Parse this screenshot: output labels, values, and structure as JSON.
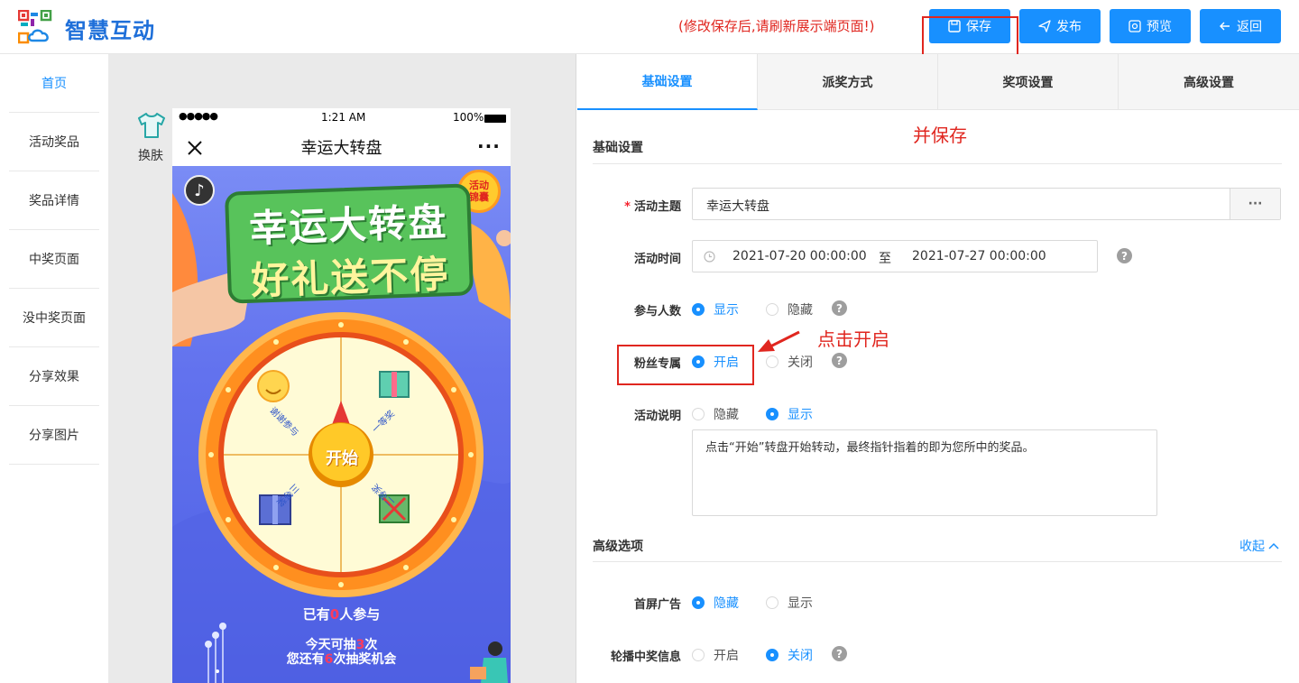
{
  "header": {
    "app_name": "智慧互动",
    "notice": "(修改保存后,请刷新展示端页面!)",
    "buttons": {
      "save": "保存",
      "publish": "发布",
      "preview": "预览",
      "back": "返回"
    }
  },
  "annotations": {
    "save_hint": "并保存",
    "open_hint": "点击开启"
  },
  "colors": {
    "primary": "#1890ff",
    "alert": "#e0261f"
  },
  "leftnav": {
    "items": [
      "首页",
      "活动奖品",
      "奖品详情",
      "中奖页面",
      "没中奖页面",
      "分享效果",
      "分享图片"
    ]
  },
  "preview": {
    "skin_label": "换肤",
    "status": {
      "signal": "●●●●●",
      "time": "1:21 AM",
      "battery": "100%"
    },
    "title": "幸运大转盘",
    "banner": {
      "line1": "幸运大转盘",
      "line2": "好礼送不停"
    },
    "badge": {
      "line1": "活动",
      "line2": "锦囊"
    },
    "wheel": {
      "start": "开始",
      "prizes": [
        "谢谢参与",
        "一等奖",
        "二等奖",
        "三等奖"
      ]
    },
    "participants": {
      "prefix": "已有",
      "count": "0",
      "suffix": "人参与"
    },
    "today": {
      "prefix": "今天可抽",
      "count": "3",
      "suffix": "次"
    },
    "remaining": {
      "prefix": "您还有",
      "count": "6",
      "suffix": "次抽奖机会"
    }
  },
  "tabs": [
    "基础设置",
    "派奖方式",
    "奖项设置",
    "高级设置"
  ],
  "form": {
    "basic_title": "基础设置",
    "topic": {
      "label": "活动主题",
      "value": "幸运大转盘",
      "more": "···"
    },
    "time": {
      "label": "活动时间",
      "start": "2021-07-20 00:00:00",
      "sep": "至",
      "end": "2021-07-27 00:00:00"
    },
    "participants": {
      "label": "参与人数",
      "options": [
        "显示",
        "隐藏"
      ],
      "selected": 0
    },
    "fans_only": {
      "label": "粉丝专属",
      "options": [
        "开启",
        "关闭"
      ],
      "selected": 0
    },
    "description": {
      "label": "活动说明",
      "options": [
        "隐藏",
        "显示"
      ],
      "selected": 1,
      "text": "点击“开始”转盘开始转动，最终指针指着的即为您所中的奖品。"
    },
    "advanced_title": "高级选项",
    "collapse": "收起",
    "splash_ad": {
      "label": "首屏广告",
      "options": [
        "隐藏",
        "显示"
      ],
      "selected": 0
    },
    "carousel": {
      "label": "轮播中奖信息",
      "options": [
        "开启",
        "关闭"
      ],
      "selected": 1
    },
    "help_glyph": "?"
  }
}
